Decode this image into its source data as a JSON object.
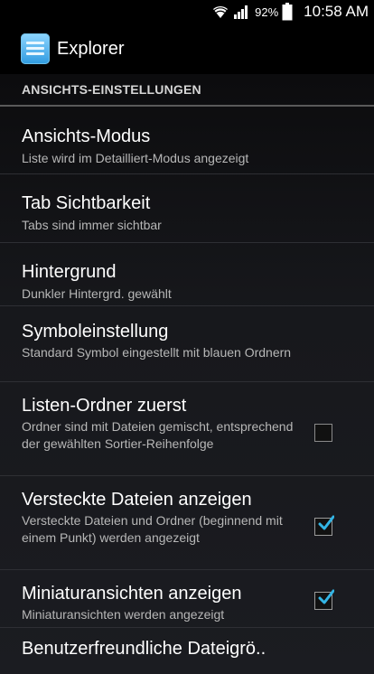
{
  "status_bar": {
    "battery_percent": "92%",
    "time": "10:58 AM",
    "icons": [
      "wifi-icon",
      "signal-icon",
      "battery-icon"
    ]
  },
  "action_bar": {
    "title": "Explorer",
    "icon": "explorer-app-icon"
  },
  "section": {
    "header": "ANSICHTS-EINSTELLUNGEN"
  },
  "prefs": [
    {
      "title": "Ansichts-Modus",
      "summary": "Liste wird im Detailliert-Modus angezeigt"
    },
    {
      "title": "Tab Sichtbarkeit",
      "summary": "Tabs sind immer sichtbar"
    },
    {
      "title": "Hintergrund",
      "summary": "Dunkler Hintergrd. gewählt"
    },
    {
      "title": "Symboleinstellung",
      "summary": "Standard Symbol eingestellt mit blauen Ordnern"
    },
    {
      "title": "Listen-Ordner zuerst",
      "summary": "Ordner sind mit Dateien gemischt, entsprechend der gewählten Sortier-Reihenfolge",
      "checked": false
    },
    {
      "title": "Versteckte Dateien anzeigen",
      "summary": "Versteckte Dateien und Ordner (beginnend mit einem Punkt) werden angezeigt",
      "checked": true
    },
    {
      "title": "Miniaturansichten anzeigen",
      "summary": "Miniaturansichten werden angezeigt",
      "checked": true
    },
    {
      "title": "Benutzerfreundliche Dateigrö.."
    }
  ],
  "colors": {
    "accent": "#33b5e5",
    "background": "#000000",
    "divider": "#2e2f34"
  }
}
